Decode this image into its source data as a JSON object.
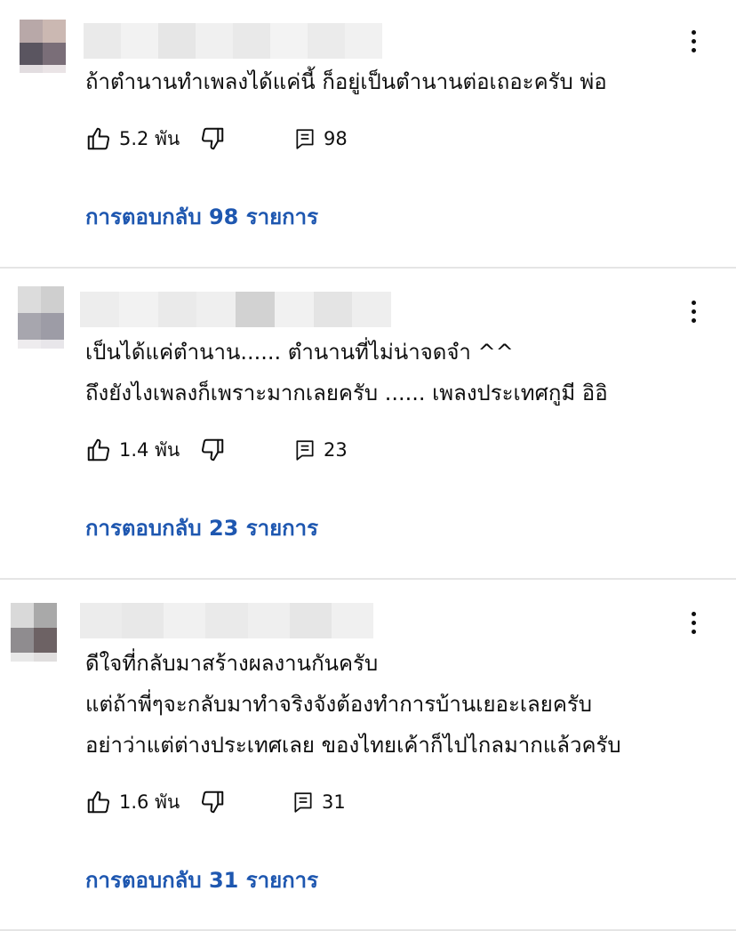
{
  "comments": [
    {
      "text_lines": [
        "ถ้าตำนานทำเพลงได้แค่นี้ ก็อยู่เป็นตำนานต่อเถอะครับ พ่อ"
      ],
      "likes": "5.2 พัน",
      "reply_count": "98",
      "replies_link": "การตอบกลับ 98 รายการ"
    },
    {
      "text_lines": [
        "เป็นได้แค่ตำนาน...... ตำนานที่ไม่น่าจดจำ ^^",
        "ถึงยังไงเพลงก็เพราะมากเลยครับ ...... เพลงประเทศกูมี อิอิ"
      ],
      "likes": "1.4 พัน",
      "reply_count": "23",
      "replies_link": "การตอบกลับ 23 รายการ"
    },
    {
      "text_lines": [
        "ดีใจที่กลับมาสร้างผลงานกันครับ",
        "แต่ถ้าพี่ๆจะกลับมาทำจริงจังต้องทำการบ้านเยอะเลยครับ",
        "อย่าว่าแต่ต่างประเทศเลย ของไทยเค้าก็ไปไกลมากแล้วครับ"
      ],
      "likes": "1.6 พัน",
      "reply_count": "31",
      "replies_link": "การตอบกลับ 31 รายการ"
    }
  ],
  "colors": {
    "link": "#1e57b0",
    "divider": "#e5e5e5",
    "text": "#0f0f0f"
  },
  "icons": [
    "like-icon",
    "dislike-icon",
    "reply-icon",
    "more-vert-icon"
  ]
}
